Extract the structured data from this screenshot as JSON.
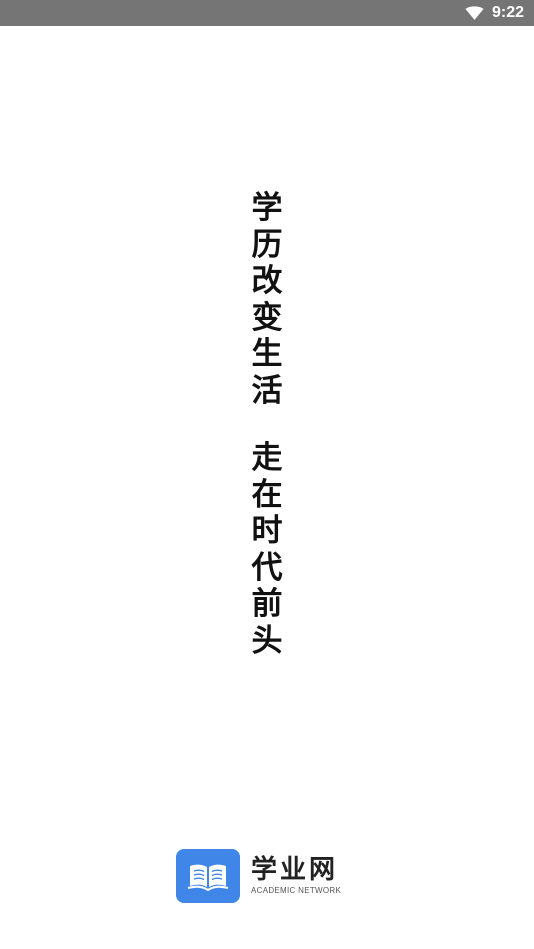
{
  "status_bar": {
    "time": "9:22",
    "icons": [
      "wifi-icon"
    ]
  },
  "slogan": {
    "line1": [
      "学",
      "历",
      "改",
      "变",
      "生",
      "活"
    ],
    "line2": [
      "走",
      "在",
      "时",
      "代",
      "前",
      "头"
    ]
  },
  "brand": {
    "name": "学业网",
    "subtitle": "ACADEMIC NETWORK",
    "logo_icon": "open-book-icon",
    "accent_color": "#3f86e8"
  }
}
